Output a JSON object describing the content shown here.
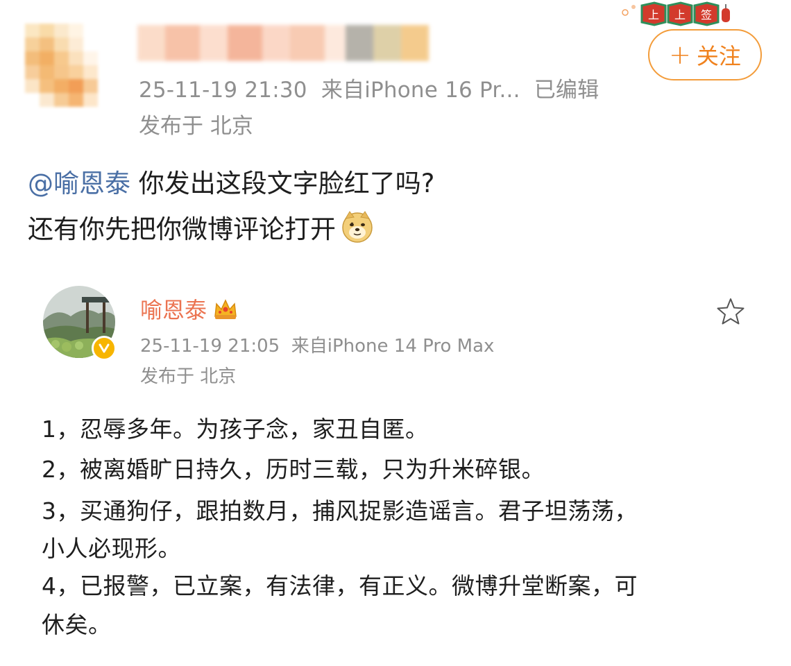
{
  "header": {
    "timestamp": "25-11-19 21:30",
    "source": "来自iPhone 16 Pr...",
    "edited": "已编辑",
    "location": "发布于 北京",
    "follow_label": "关注",
    "follow_plus": "+"
  },
  "post": {
    "mention": "@喻恩泰",
    "line1_text": " 你发出这段文字脸红了吗?",
    "line2_text": "还有你先把你微博评论打开",
    "emoji": "doge-emoji"
  },
  "quoted": {
    "username": "喻恩泰",
    "timestamp": "25-11-19 21:05",
    "source": "来自iPhone 14 Pro Max",
    "location": "发布于 北京",
    "lines": [
      "1，忍辱多年。为孩子念，家丑自匿。",
      "2，被离婚旷日持久，历时三载，只为升米碎银。",
      "3，买通狗仔，跟拍数月，捕风捉影造谣言。君子坦荡荡，",
      "小人必现形。",
      "4，已报警，已立案，有法律，有正义。微博升堂断案，可",
      "休矣。"
    ]
  },
  "colors": {
    "accent_orange": "#f0821e",
    "mention_blue": "#4a6fa5",
    "username_orange": "#eb7350",
    "meta_gray": "#8f8f8f"
  }
}
